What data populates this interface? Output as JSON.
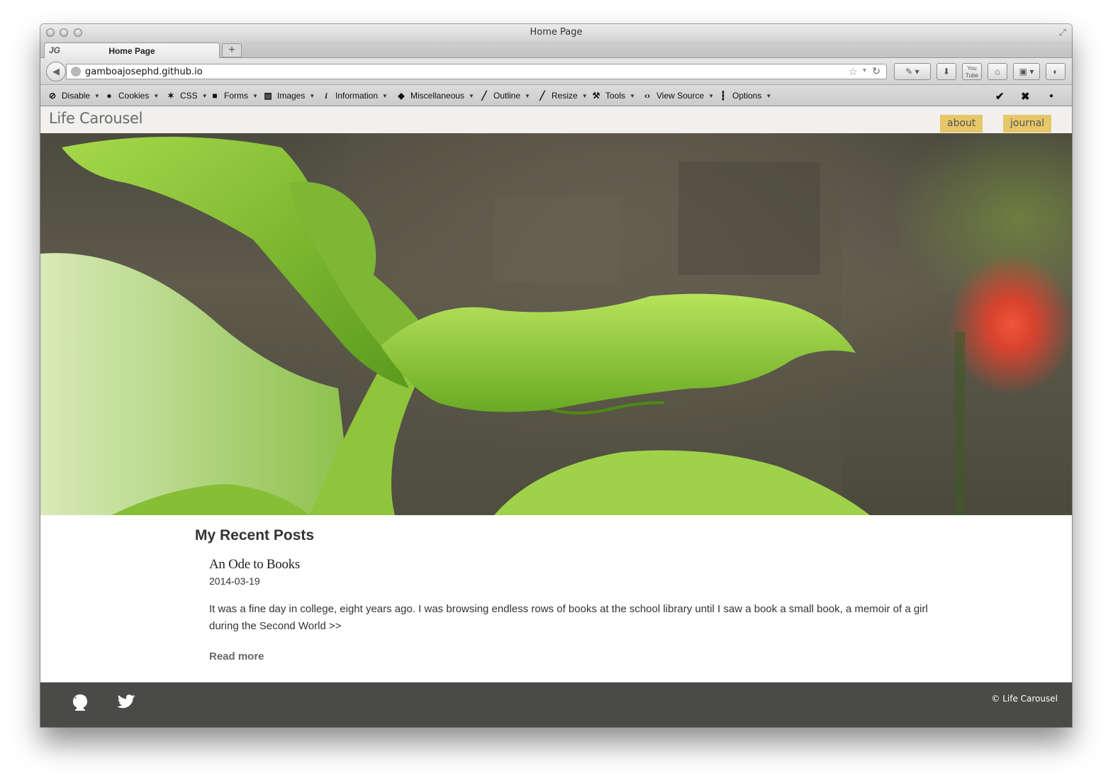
{
  "window": {
    "title": "Home Page"
  },
  "tabs": [
    {
      "favicon": "JG",
      "label": "Home Page"
    }
  ],
  "new_tab": "+",
  "address_bar": {
    "url": "gamboajosephd.github.io"
  },
  "dev_toolbar": [
    {
      "icon": "disable-icon",
      "label": "Disable"
    },
    {
      "icon": "cookies-icon",
      "label": "Cookies"
    },
    {
      "icon": "css-icon",
      "label": "CSS"
    },
    {
      "icon": "forms-icon",
      "label": "Forms"
    },
    {
      "icon": "images-icon",
      "label": "Images"
    },
    {
      "icon": "information-icon",
      "label": "Information"
    },
    {
      "icon": "miscellaneous-icon",
      "label": "Miscellaneous"
    },
    {
      "icon": "outline-icon",
      "label": "Outline"
    },
    {
      "icon": "resize-icon",
      "label": "Resize"
    },
    {
      "icon": "tools-icon",
      "label": "Tools"
    },
    {
      "icon": "view-source-icon",
      "label": "View Source"
    },
    {
      "icon": "options-icon",
      "label": "Options"
    }
  ],
  "site": {
    "brand": "Life Carousel",
    "nav": [
      {
        "label": "about"
      },
      {
        "label": "journal"
      }
    ]
  },
  "main": {
    "section_title": "My Recent Posts",
    "posts": [
      {
        "title": "An Ode to Books",
        "date": "2014-03-19",
        "excerpt": "It was a fine day in college, eight years ago. I was browsing endless rows of books at the school library until I saw a book a small book, a memoir of a girl during the Second World >>",
        "read_more": "Read more"
      }
    ]
  },
  "footer": {
    "icons": [
      "github-icon",
      "twitter-icon"
    ],
    "copyright": "© Life Carousel"
  },
  "colors": {
    "nav_button": "#e6c769",
    "footer_bg": "#4a4a48",
    "header_bg": "#f1f0ee"
  }
}
